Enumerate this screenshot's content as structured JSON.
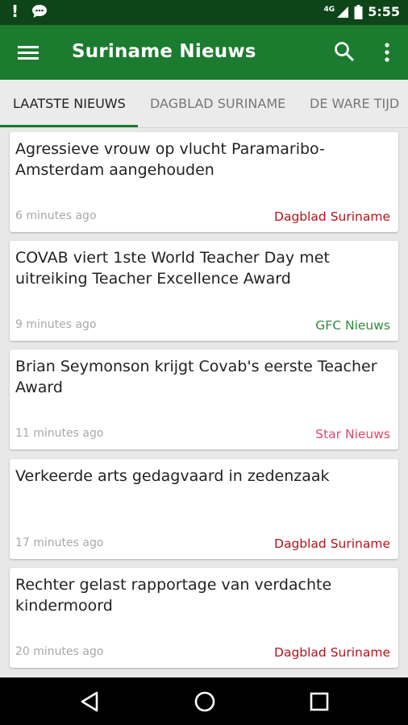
{
  "status_bar": {
    "network": "4G",
    "time": "5:55"
  },
  "app_bar": {
    "title": "Suriname Nieuws"
  },
  "tabs": [
    {
      "label": "LAATSTE NIEUWS",
      "active": true
    },
    {
      "label": "DAGBLAD SURINAME",
      "active": false
    },
    {
      "label": "DE WARE TIJD",
      "active": false
    }
  ],
  "articles": [
    {
      "headline": "Agressieve vrouw op vlucht Paramaribo-Amsterdam aangehouden",
      "time": "6 minutes ago",
      "source": "Dagblad Suriname",
      "source_color": "#b5121b"
    },
    {
      "headline": "COVAB viert 1ste World Teacher Day met uitreiking Teacher Excellence Award",
      "time": "9 minutes ago",
      "source": "GFC Nieuws",
      "source_color": "#2e8b3d"
    },
    {
      "headline": "Brian Seymonson krijgt Covab's eerste Teacher Award",
      "time": "11 minutes ago",
      "source": "Star Nieuws",
      "source_color": "#e0476b"
    },
    {
      "headline": "Verkeerde arts gedagvaard in zedenzaak",
      "time": "17 minutes ago",
      "source": "Dagblad Suriname",
      "source_color": "#b5121b"
    },
    {
      "headline": "Rechter gelast rapportage van verdachte kindermoord",
      "time": "20 minutes ago",
      "source": "Dagblad Suriname",
      "source_color": "#b5121b"
    }
  ],
  "colors": {
    "status_bar": "#0d4519",
    "app_bar": "#1b7b2f",
    "accent": "#1b7b2f"
  }
}
